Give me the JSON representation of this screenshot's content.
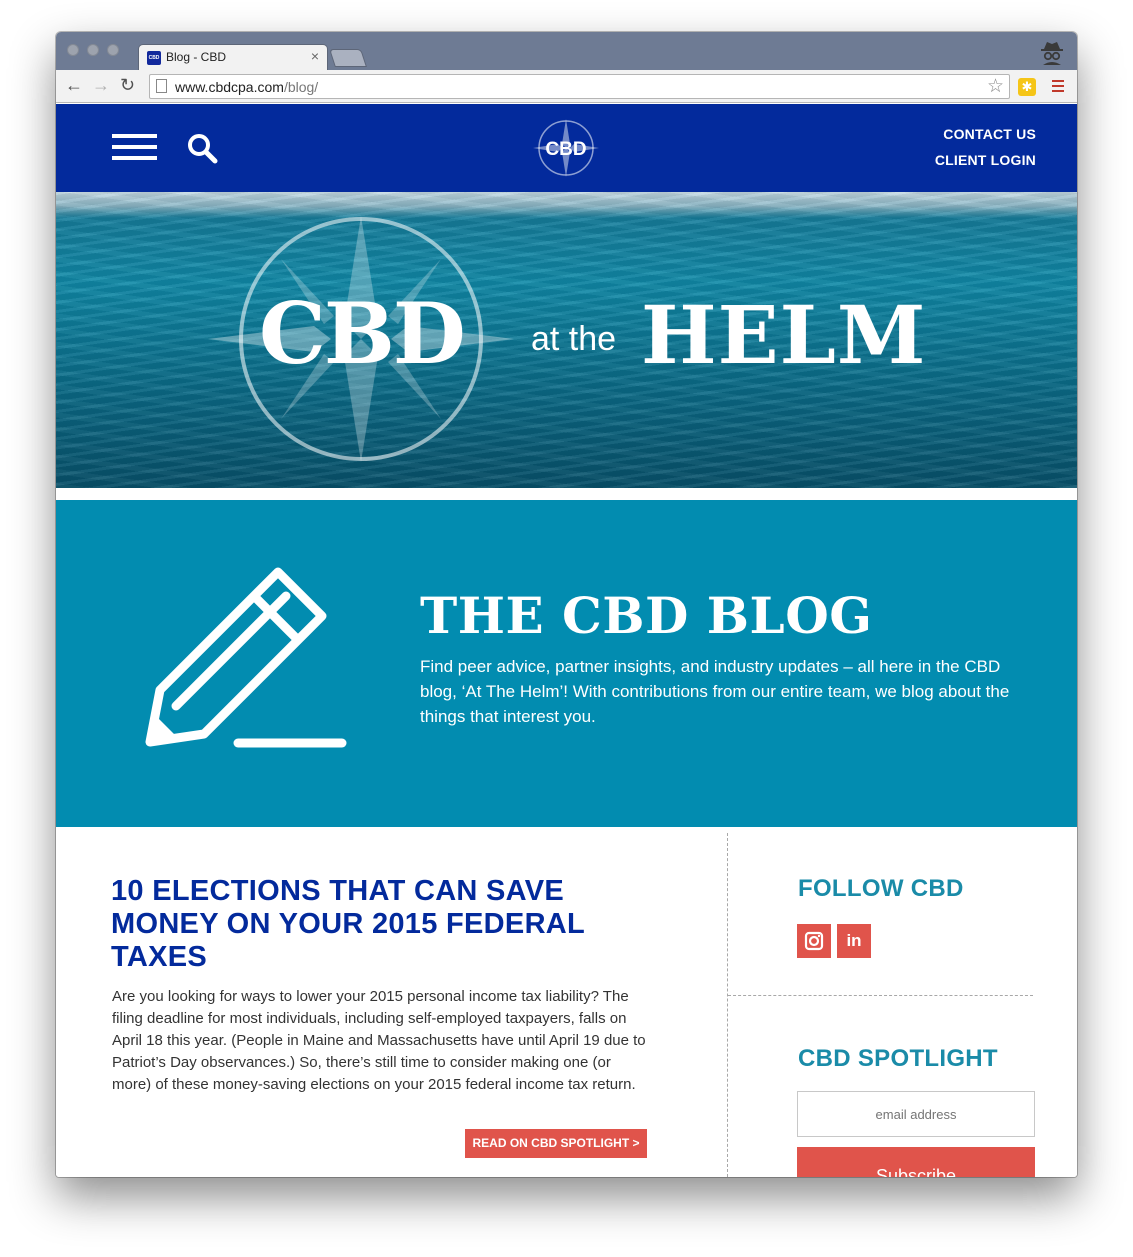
{
  "browser": {
    "tab_title": "Blog - CBD",
    "tab_favicon_text": "CBD",
    "url_host": "www.cbdcpa.com",
    "url_path": "/blog/",
    "back_icon": "←",
    "forward_icon": "→",
    "reload_icon": "↻",
    "close_icon": "×",
    "star_icon": "☆",
    "ext_icon": "✱"
  },
  "header": {
    "logo_text": "CBD",
    "contact_label": "CONTACT US",
    "login_label": "CLIENT LOGIN",
    "bg_color": "#032a9c"
  },
  "hero": {
    "brand": "CBD",
    "connector": "at the",
    "tagline": "HELM"
  },
  "intro": {
    "title": "THE CBD BLOG",
    "text": "Find peer advice, partner insights, and industry updates – all here in the CBD blog, ‘At The Helm’! With contributions from our entire team, we blog about the things that interest you.",
    "bg_color": "#028cb0"
  },
  "post": {
    "title": "10 ELECTIONS THAT CAN SAVE MONEY ON YOUR 2015 FEDERAL TAXES",
    "excerpt": "Are you looking for ways to lower your 2015 personal income tax liability? The filing deadline for most individuals, including self-employed taxpayers, falls on April 18 this year. (People in Maine and Massachusetts have until April 19 due to Patriot’s Day observances.) So, there’s still time to consider making one (or more) of these money-saving elections on your 2015 federal income tax return.",
    "read_more": "READ ON CBD SPOTLIGHT >"
  },
  "sidebar": {
    "follow_title": "FOLLOW CBD",
    "linkedin_label": "in",
    "spotlight_title": "CBD SPOTLIGHT",
    "email_placeholder": "email address",
    "subscribe_label": "Subscribe",
    "accent_color": "#e0544b"
  }
}
